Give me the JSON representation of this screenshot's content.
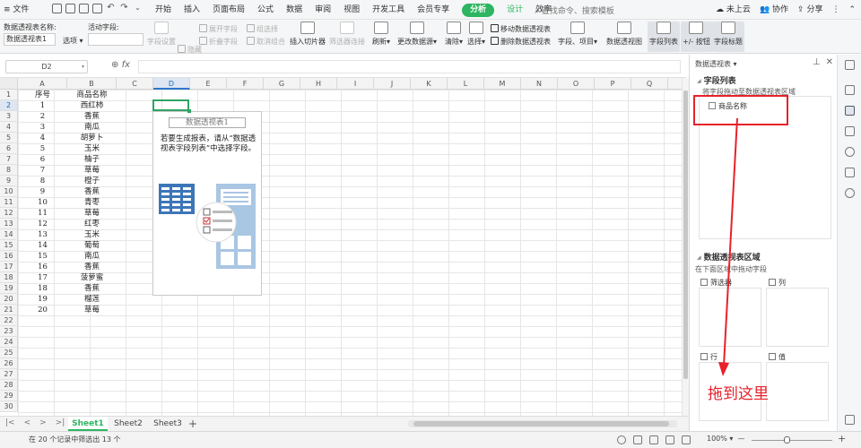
{
  "menubar": {
    "file_label": "≡ 文件",
    "tabs": [
      "开始",
      "插入",
      "页面布局",
      "公式",
      "数据",
      "审阅",
      "视图",
      "开发工具",
      "会员专享",
      "分析",
      "设计",
      "效率"
    ],
    "active_tab": "分析",
    "search_placeholder": "查找命令、搜索模板",
    "cloud_label": "未上云",
    "collab_label": "协作",
    "share_label": "分享"
  },
  "ribbon": {
    "pivot_name_label": "数据透视表名称:",
    "pivot_name_value": "数据透视表1",
    "options_label": "选项",
    "active_field_label": "活动字段:",
    "field_settings": "字段设置",
    "hide": "隐藏",
    "expand_field": "展开字段",
    "collapse_field": "折叠字段",
    "group_selection": "组选择",
    "ungroup": "取消组合",
    "insert_slicer": "插入切片器",
    "filter_connection": "筛选器连接",
    "refresh": "刷新",
    "change_source": "更改数据源",
    "clear": "清除",
    "select": "选择",
    "move_pivot": "移动数据透视表",
    "delete_pivot": "删除数据透视表",
    "fields_items": "字段、项目",
    "pivot_view": "数据透视图",
    "field_list": "字段列表",
    "plus_minus_buttons": "+/- 按钮",
    "field_headers": "字段标题"
  },
  "formula_bar": {
    "name_box": "D2",
    "fx_label": "fx",
    "formula": ""
  },
  "grid": {
    "columns": [
      "A",
      "B",
      "C",
      "D",
      "E",
      "F",
      "G",
      "H",
      "I",
      "J",
      "K",
      "L",
      "M",
      "N",
      "O",
      "P",
      "Q",
      "R"
    ],
    "selected_column": "D",
    "row_numbers": [
      "1",
      "2",
      "3",
      "4",
      "5",
      "6",
      "7",
      "8",
      "9",
      "10",
      "11",
      "12",
      "13",
      "14",
      "15",
      "16",
      "17",
      "18",
      "19",
      "20",
      "21",
      "22",
      "23",
      "24",
      "25",
      "26",
      "27",
      "28",
      "29",
      "30"
    ],
    "selected_row": "2",
    "header_row": [
      "序号",
      "商品名称"
    ],
    "rows": [
      [
        "1",
        "西红柿"
      ],
      [
        "2",
        "香蕉"
      ],
      [
        "3",
        "南瓜"
      ],
      [
        "4",
        "胡萝卜"
      ],
      [
        "5",
        "玉米"
      ],
      [
        "6",
        "柚子"
      ],
      [
        "7",
        "草莓"
      ],
      [
        "8",
        "橙子"
      ],
      [
        "9",
        "香蕉"
      ],
      [
        "10",
        "青枣"
      ],
      [
        "11",
        "草莓"
      ],
      [
        "12",
        "红枣"
      ],
      [
        "13",
        "玉米"
      ],
      [
        "14",
        "葡萄"
      ],
      [
        "15",
        "南瓜"
      ],
      [
        "16",
        "香蕉"
      ],
      [
        "17",
        "菠萝蜜"
      ],
      [
        "18",
        "香蕉"
      ],
      [
        "19",
        "榴莲"
      ],
      [
        "20",
        "草莓"
      ]
    ]
  },
  "pivot_placeholder": {
    "title": "数据透视表1",
    "text": "若要生成报表，请从“数据透视表字段列表”中选择字段。"
  },
  "sheets": {
    "tabs": [
      "Sheet1",
      "Sheet2",
      "Sheet3"
    ],
    "active": "Sheet1",
    "add_label": "+"
  },
  "status": {
    "message": "在 20 个记录中筛选出 13 个",
    "zoom": "100%"
  },
  "pane": {
    "title": "数据透视表 ▾",
    "field_list_header": "字段列表",
    "field_list_hint": "将字段拖动至数据透视表区域",
    "fields": [
      "商品名称"
    ],
    "areas_header": "数据透视表区域",
    "areas_hint": "在下面区域中拖动字段",
    "filter_label": "筛选器",
    "column_label": "列",
    "row_label": "行",
    "value_label": "值"
  },
  "annotation": {
    "text": "拖到这里",
    "color": "#e8212a"
  },
  "colors": {
    "accent_green": "#2db561",
    "selection_blue": "#2f76c9"
  }
}
